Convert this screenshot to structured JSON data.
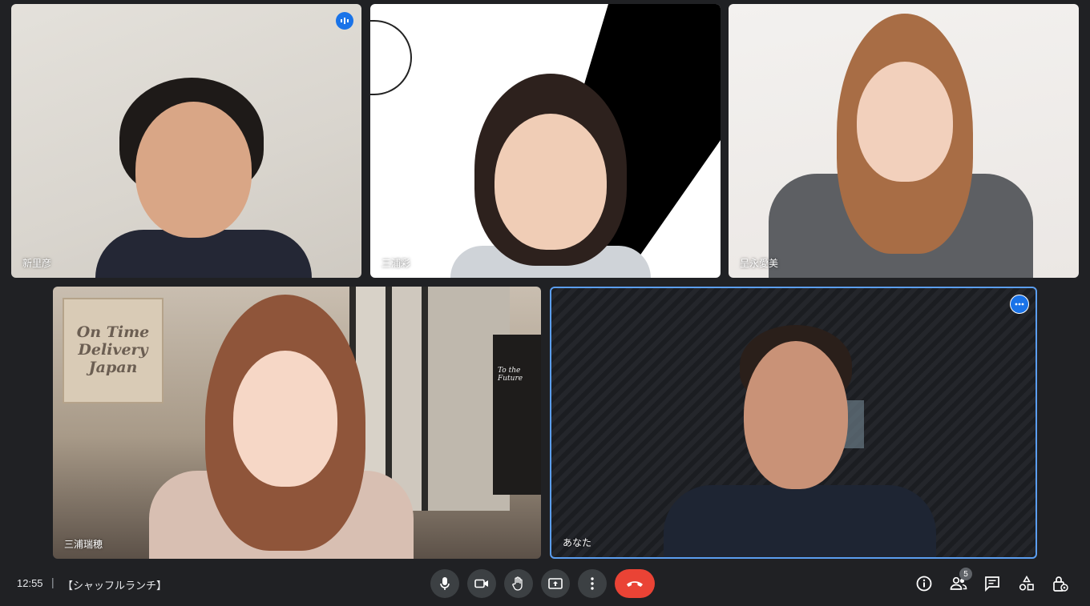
{
  "participants": [
    {
      "name": "新里彦"
    },
    {
      "name": "三浦彩"
    },
    {
      "name": "呈永愛美"
    },
    {
      "name": "三浦瑞穂"
    },
    {
      "name": "あなた"
    }
  ],
  "tile_art": {
    "sign_text": "On Time Delivery Japan",
    "poster_text": "To the Future"
  },
  "bottom_bar": {
    "time": "12:55",
    "separator": "|",
    "meeting_title": "【シャッフルランチ】",
    "participant_count": "5"
  },
  "icons": {
    "speaking": "audio-level-icon",
    "more": "more-options-icon",
    "mic": "microphone-icon",
    "camera": "camera-icon",
    "hand": "raise-hand-icon",
    "present": "present-screen-icon",
    "menu": "more-vert-icon",
    "end": "end-call-icon",
    "info": "info-icon",
    "people": "people-icon",
    "chat": "chat-icon",
    "activities": "activities-icon",
    "lock": "host-controls-icon"
  },
  "colors": {
    "background": "#202124",
    "control_bg": "#3c4043",
    "end_call": "#ea4335",
    "accent": "#1a73e8",
    "active_border": "#5b9ef0"
  }
}
